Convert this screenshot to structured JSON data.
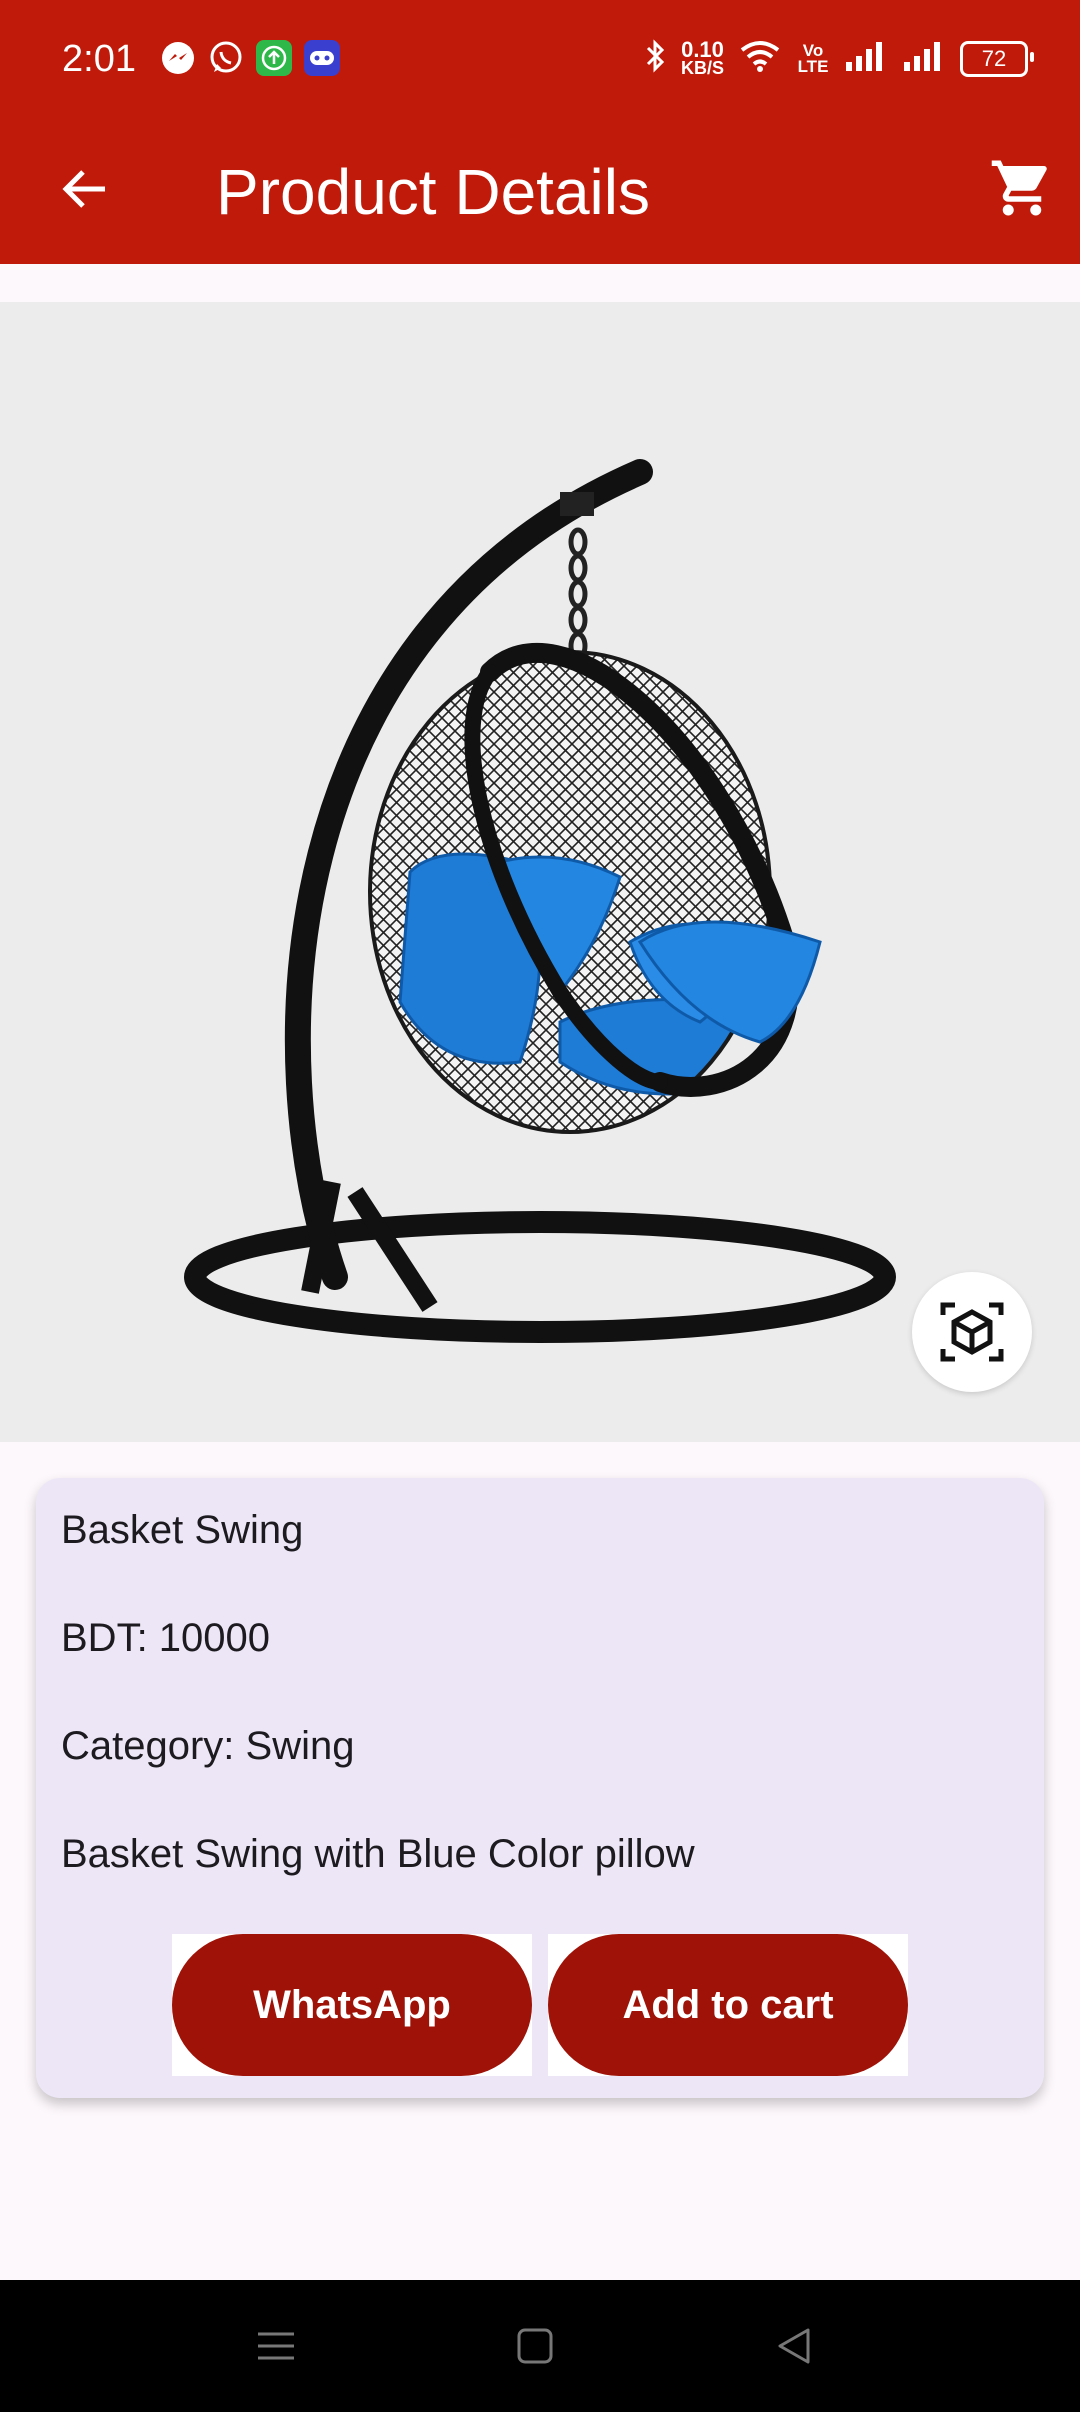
{
  "status_bar": {
    "time": "2:01",
    "net_speed_value": "0.10",
    "net_speed_unit": "KB/S",
    "volte_label": "Vo LTE",
    "battery": "72",
    "notification_icons": [
      "messenger-icon",
      "whatsapp-icon",
      "upload-icon",
      "game-icon"
    ]
  },
  "app_bar": {
    "title": "Product Details",
    "back_icon": "arrow-left-icon",
    "cart_icon": "shopping-cart-icon"
  },
  "product": {
    "name": "Basket Swing",
    "price": "BDT: 10000",
    "category": "Category: Swing",
    "description": "Basket Swing with Blue Color pillow"
  },
  "actions": {
    "whatsapp_label": "WhatsApp",
    "add_to_cart_label": "Add to cart"
  },
  "colors": {
    "primary": "#bf1a0a",
    "button": "#9e1208",
    "card": "#ede6f6",
    "pillow": "#1e7bd6"
  }
}
